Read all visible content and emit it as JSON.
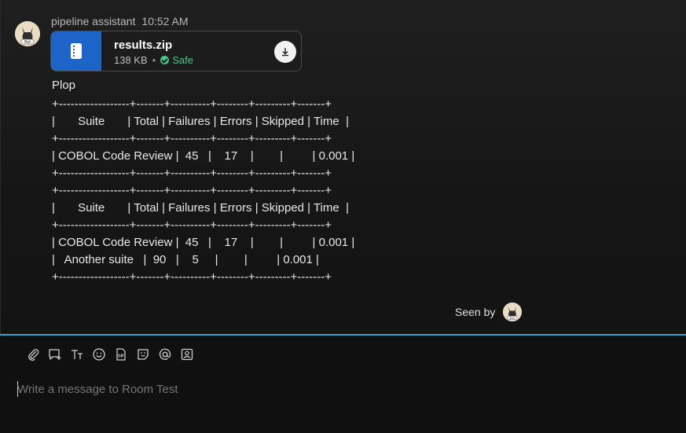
{
  "message": {
    "sender": "pipeline assistant",
    "time": "10:52 AM",
    "file": {
      "name": "results.zip",
      "size": "138 KB",
      "status": "Safe"
    },
    "text": "Plop",
    "table_lines": [
      "+------------------+-------+----------+--------+---------+-------+",
      "|       Suite       | Total | Failures | Errors | Skipped | Time  |",
      "+------------------+-------+----------+--------+---------+-------+",
      "| COBOL Code Review |  45   |    17    |        |         | 0.001 |",
      "+------------------+-------+----------+--------+---------+-------+",
      "+------------------+-------+----------+--------+---------+-------+",
      "|       Suite       | Total | Failures | Errors | Skipped | Time  |",
      "+------------------+-------+----------+--------+---------+-------+",
      "| COBOL Code Review |  45   |    17    |        |         | 0.001 |",
      "|   Another suite   |  90   |    5     |        |         | 0.001 |",
      "+------------------+-------+----------+--------+---------+-------+"
    ]
  },
  "seen_by_label": "Seen by",
  "composer": {
    "placeholder": "Write a message to Room Test"
  },
  "colors": {
    "accent": "#3a9fd0",
    "file_icon_bg": "#1d64c8",
    "safe": "#4cc38a"
  }
}
